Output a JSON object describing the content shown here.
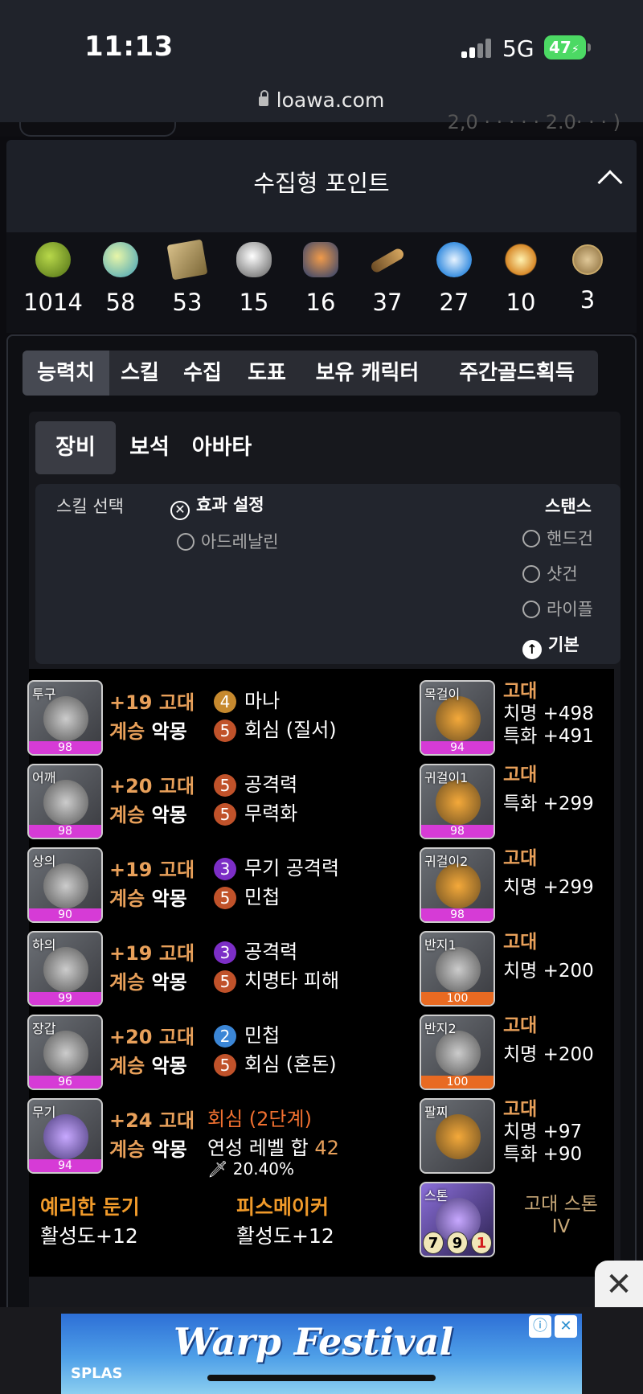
{
  "status_bar": {
    "time": "11:13",
    "network": "5G",
    "battery": "47"
  },
  "browser": {
    "url": "loawa.com"
  },
  "collect_panel": {
    "title": "수집형 포인트",
    "items": [
      {
        "icon": "mokoko-seed-icon",
        "value": "1014"
      },
      {
        "icon": "island-heart-icon",
        "value": "58"
      },
      {
        "icon": "adventure-map-icon",
        "value": "53"
      },
      {
        "icon": "giant-heart-icon",
        "value": "15"
      },
      {
        "icon": "ignea-token-icon",
        "value": "16"
      },
      {
        "icon": "art-telescope-icon",
        "value": "37"
      },
      {
        "icon": "world-tree-leaf-icon",
        "value": "27"
      },
      {
        "icon": "sea-bounty-icon",
        "value": "10"
      },
      {
        "icon": "orpheus-star-icon",
        "value": "3"
      }
    ]
  },
  "main_tabs": [
    "능력치",
    "스킬",
    "수집",
    "도표",
    "보유 캐릭터",
    "주간골드획득"
  ],
  "sub_tabs": [
    "장비",
    "보석",
    "아바타"
  ],
  "skill_box": {
    "label": "스킬 선택",
    "effect_label": "효과 설정",
    "adrenaline": "아드레날린",
    "stance_label": "스탠스",
    "stances": [
      "핸드건",
      "샷건",
      "라이플",
      "기본"
    ]
  },
  "equipment": [
    {
      "slot": "투구",
      "quality": "98",
      "level": "+19 고대",
      "inherit": "계승",
      "inherit_tier": "악몽",
      "eng1_lv": "4",
      "eng1": "마나",
      "eng2_lv": "5",
      "eng2": "회심 (질서)"
    },
    {
      "slot": "어깨",
      "quality": "98",
      "level": "+20 고대",
      "inherit": "계승",
      "inherit_tier": "악몽",
      "eng1_lv": "5",
      "eng1": "공격력",
      "eng2_lv": "5",
      "eng2": "무력화"
    },
    {
      "slot": "상의",
      "quality": "90",
      "level": "+19 고대",
      "inherit": "계승",
      "inherit_tier": "악몽",
      "eng1_lv": "3",
      "eng1": "무기 공격력",
      "eng2_lv": "5",
      "eng2": "민첩"
    },
    {
      "slot": "하의",
      "quality": "99",
      "level": "+19 고대",
      "inherit": "계승",
      "inherit_tier": "악몽",
      "eng1_lv": "3",
      "eng1": "공격력",
      "eng2_lv": "5",
      "eng2": "치명타 피해"
    },
    {
      "slot": "장갑",
      "quality": "96",
      "level": "+20 고대",
      "inherit": "계승",
      "inherit_tier": "악몽",
      "eng1_lv": "2",
      "eng1": "민첩",
      "eng2_lv": "5",
      "eng2": "회심 (혼돈)"
    },
    {
      "slot": "무기",
      "quality": "94",
      "level": "+24 고대",
      "inherit": "계승",
      "inherit_tier": "악몽"
    }
  ],
  "weapon_extra": {
    "effect": "회심 (2단계)",
    "sum_label": "연성 레벨 합",
    "sum_value": "42",
    "percent": "20.40%"
  },
  "accessories": [
    {
      "slot": "목걸이",
      "quality": "94",
      "grade": "고대",
      "stat1": "치명 +498",
      "stat2": "특화 +491"
    },
    {
      "slot": "귀걸이1",
      "quality": "98",
      "grade": "고대",
      "stat1": "특화 +299"
    },
    {
      "slot": "귀걸이2",
      "quality": "98",
      "grade": "고대",
      "stat1": "치명 +299"
    },
    {
      "slot": "반지1",
      "quality": "100",
      "grade": "고대",
      "stat1": "치명 +200"
    },
    {
      "slot": "반지2",
      "quality": "100",
      "grade": "고대",
      "stat1": "치명 +200"
    },
    {
      "slot": "팔찌",
      "grade": "고대",
      "stat1": "치명 +97",
      "stat2": "특화 +90"
    }
  ],
  "stone": {
    "slot": "스톤",
    "name": "고대 스톤",
    "tier": "IV",
    "v1": "7",
    "v2": "9",
    "v3": "1"
  },
  "set_effects": [
    {
      "name": "예리한 둔기",
      "value": "활성도+12"
    },
    {
      "name": "피스메이커",
      "value": "활성도+12"
    }
  ],
  "ad": {
    "title": "Warp Festival",
    "brand": "SPLAS",
    "close": "✕"
  }
}
